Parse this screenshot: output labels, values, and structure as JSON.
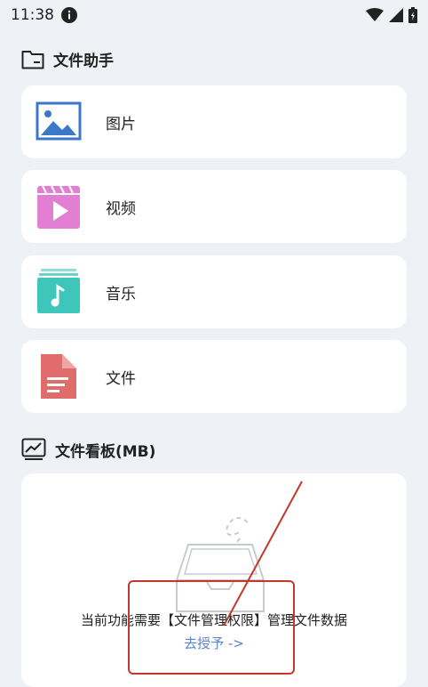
{
  "status_bar": {
    "time": "11:38",
    "icons": [
      "info-icon",
      "wifi-icon",
      "signal-icon",
      "battery-icon"
    ]
  },
  "file_helper": {
    "title": "文件助手",
    "icon": "folder-icon",
    "items": [
      {
        "label": "图片",
        "icon": "image-icon",
        "color": "#3b78c9"
      },
      {
        "label": "视频",
        "icon": "video-icon",
        "color": "#e37fd2"
      },
      {
        "label": "音乐",
        "icon": "music-icon",
        "color": "#3fc6bb"
      },
      {
        "label": "文件",
        "icon": "document-icon",
        "color": "#e06c6c"
      }
    ]
  },
  "file_dashboard": {
    "title": "文件看板(MB)",
    "icon": "chart-board-icon",
    "empty_state": {
      "message": "当前功能需要【文件管理权限】管理文件数据",
      "action_label": "去授予 ->"
    }
  },
  "annotation": {
    "color": "#c0392b"
  }
}
